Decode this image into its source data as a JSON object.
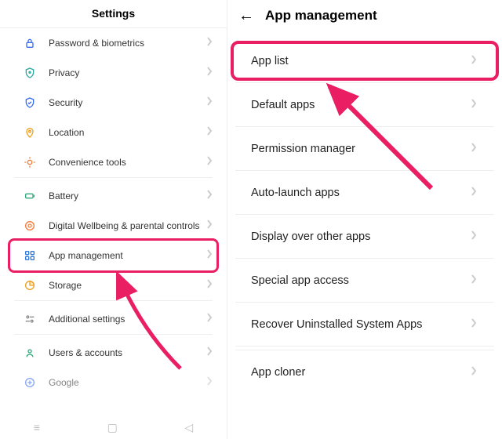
{
  "left": {
    "title": "Settings",
    "items": [
      {
        "label": "Password & biometrics",
        "icon": "lock-icon",
        "color": "#3a6cf4"
      },
      {
        "label": "Privacy",
        "icon": "shield-key-icon",
        "color": "#2fa8a0"
      },
      {
        "label": "Security",
        "icon": "shield-check-icon",
        "color": "#3a6cf4"
      },
      {
        "label": "Location",
        "icon": "location-icon",
        "color": "#f0a020"
      },
      {
        "label": "Convenience tools",
        "icon": "tools-icon",
        "color": "#f47c3a"
      },
      {
        "label": "Battery",
        "icon": "battery-icon",
        "color": "#2fa87a"
      },
      {
        "label": "Digital Wellbeing & parental controls",
        "icon": "wellbeing-icon",
        "color": "#f47c3a"
      },
      {
        "label": "App management",
        "icon": "apps-icon",
        "color": "#2f7ad8",
        "highlight": true
      },
      {
        "label": "Storage",
        "icon": "storage-icon",
        "color": "#f0a020"
      },
      {
        "label": "Additional settings",
        "icon": "sliders-icon",
        "color": "#888"
      },
      {
        "label": "Users & accounts",
        "icon": "user-icon",
        "color": "#2fa87a"
      },
      {
        "label": "Google",
        "icon": "google-icon",
        "color": "#3a6cf4"
      }
    ]
  },
  "right": {
    "title": "App management",
    "items": [
      {
        "label": "App list",
        "highlight": true
      },
      {
        "label": "Default apps"
      },
      {
        "label": "Permission manager"
      },
      {
        "label": "Auto-launch apps"
      },
      {
        "label": "Display over other apps"
      },
      {
        "label": "Special app access"
      },
      {
        "label": "Recover Uninstalled System Apps"
      },
      {
        "label": "App cloner"
      }
    ]
  },
  "annotations": {
    "highlight_color": "#e91e63"
  }
}
